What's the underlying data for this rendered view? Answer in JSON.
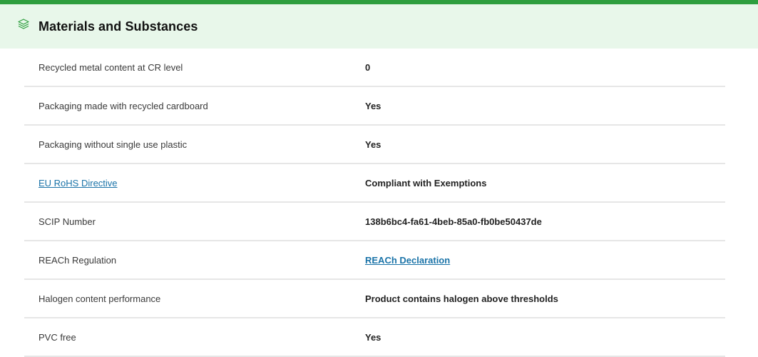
{
  "section": {
    "title": "Materials and Substances",
    "icon": "layers-icon",
    "accent_color": "#2e9e3e",
    "header_bg": "#e8f7ea",
    "link_color": "#1a73a8"
  },
  "rows": [
    {
      "label": "Recycled metal content at CR level",
      "value": "0"
    },
    {
      "label": "Packaging made with recycled cardboard",
      "value": "Yes"
    },
    {
      "label": "Packaging without single use plastic",
      "value": "Yes"
    },
    {
      "label": "EU RoHS Directive",
      "value": "Compliant with Exemptions",
      "label_is_link": true
    },
    {
      "label": "SCIP Number",
      "value": "138b6bc4-fa61-4beb-85a0-fb0be50437de"
    },
    {
      "label": "REACh Regulation",
      "value": "REACh Declaration",
      "value_is_link": true
    },
    {
      "label": "Halogen content performance",
      "value": "Product contains halogen above thresholds"
    },
    {
      "label": "PVC free",
      "value": "Yes"
    }
  ]
}
